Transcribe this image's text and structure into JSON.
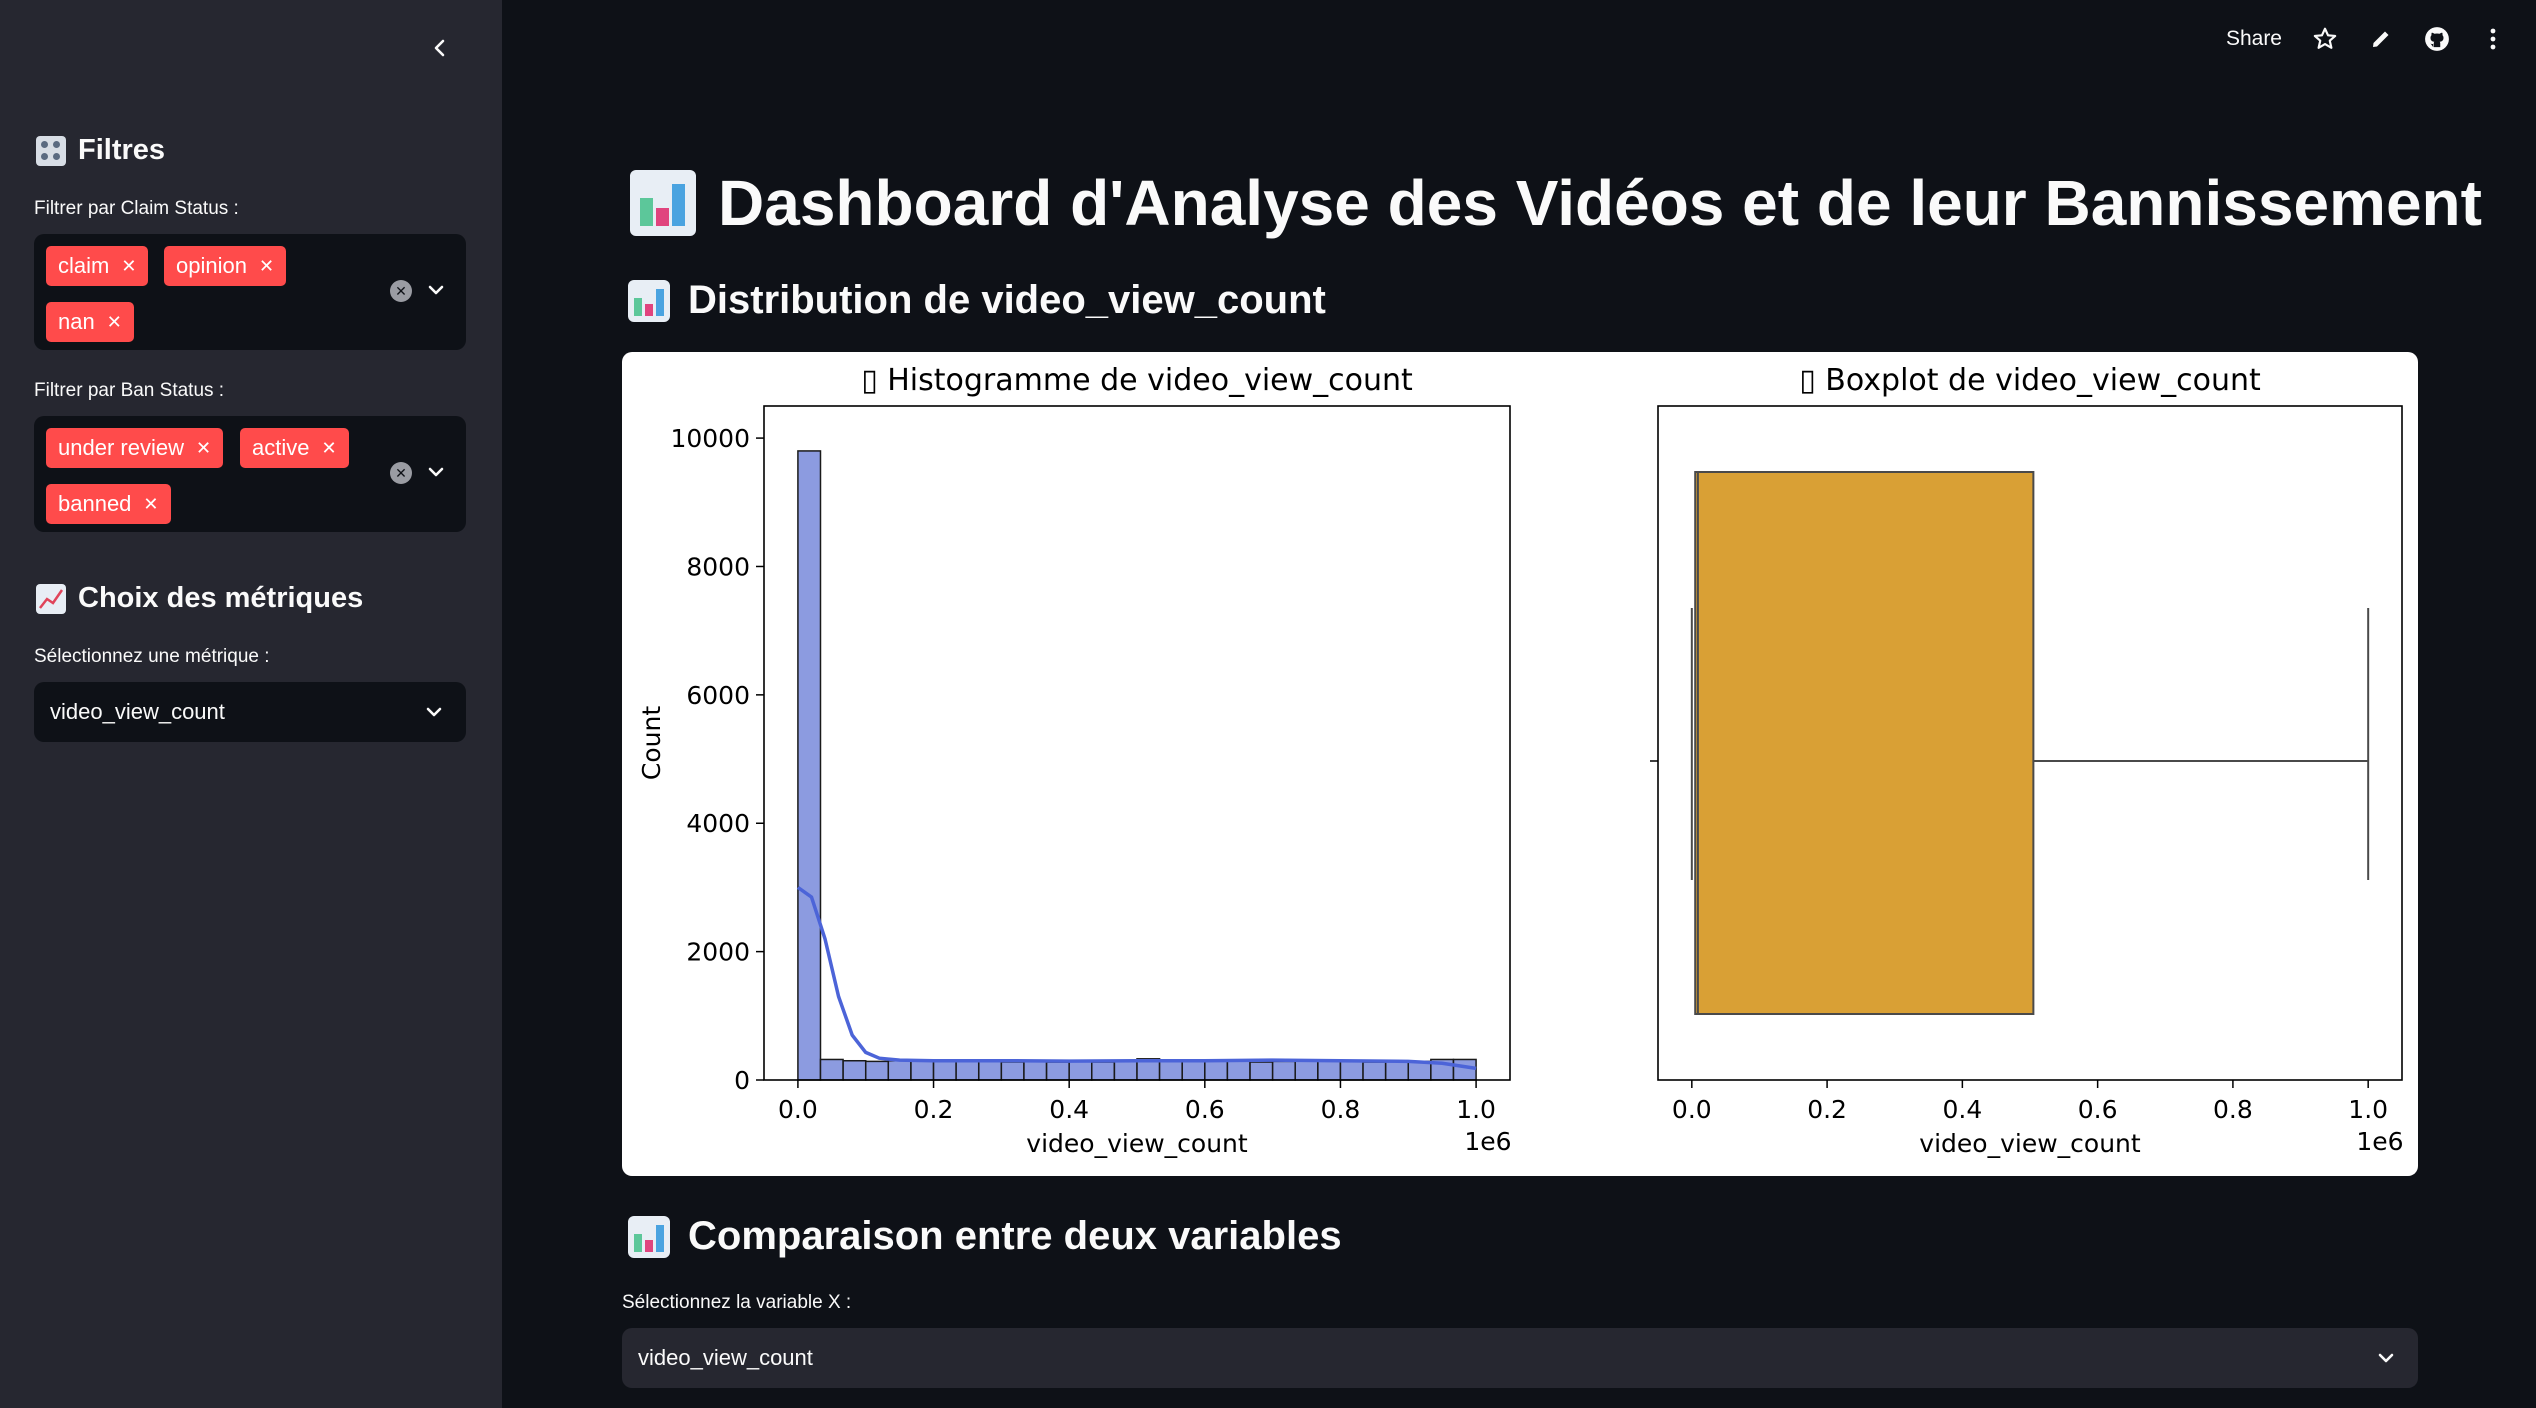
{
  "sidebar": {
    "filters_heading": "Filtres",
    "claim_label": "Filtrer par Claim Status :",
    "claim_tags": [
      "claim",
      "opinion",
      "nan"
    ],
    "ban_label": "Filtrer par Ban Status :",
    "ban_tags": [
      "under review",
      "active",
      "banned"
    ],
    "metrics_heading": "Choix des métriques",
    "metric_label": "Sélectionnez une métrique :",
    "metric_value": "video_view_count"
  },
  "toolbar": {
    "share_label": "Share"
  },
  "main": {
    "title": "Dashboard d'Analyse des Vidéos et de leur Bannissement",
    "dist_title": "Distribution de video_view_count",
    "compare_title": "Comparaison entre deux variables",
    "x_label": "Sélectionnez la variable X :",
    "x_value": "video_view_count"
  },
  "colors": {
    "accent": "#ff4b4b",
    "hist": "#8c9be0",
    "kde": "#4c64d8",
    "box": "#d9a035"
  },
  "chart_data": [
    {
      "type": "bar",
      "title": "▯ Histogramme de video_view_count",
      "xlabel": "video_view_count",
      "ylabel": "Count",
      "x_multiplier": "1e6",
      "xlim": [
        -0.05,
        1.05
      ],
      "ylim": [
        0,
        10500
      ],
      "x_ticks": [
        "0.0",
        "0.2",
        "0.4",
        "0.6",
        "0.8",
        "1.0"
      ],
      "y_ticks": [
        "0",
        "2000",
        "4000",
        "6000",
        "8000",
        "10000"
      ],
      "bin_width": 0.0333,
      "bin_starts": [
        0.0,
        0.0333,
        0.0667,
        0.1,
        0.1333,
        0.1667,
        0.2,
        0.2333,
        0.2667,
        0.3,
        0.3333,
        0.3667,
        0.4,
        0.4333,
        0.4667,
        0.5,
        0.5333,
        0.5667,
        0.6,
        0.6333,
        0.6667,
        0.7,
        0.7333,
        0.7667,
        0.8,
        0.8333,
        0.8667,
        0.9,
        0.9333,
        0.9667
      ],
      "values": [
        9800,
        320,
        300,
        290,
        300,
        300,
        290,
        295,
        290,
        280,
        290,
        280,
        300,
        280,
        300,
        330,
        310,
        290,
        300,
        300,
        280,
        290,
        300,
        310,
        300,
        280,
        300,
        290,
        320,
        320
      ],
      "kde": {
        "x": [
          0.0,
          0.02,
          0.04,
          0.06,
          0.08,
          0.1,
          0.12,
          0.15,
          0.2,
          0.3,
          0.4,
          0.5,
          0.6,
          0.7,
          0.8,
          0.9,
          0.95,
          1.0
        ],
        "y": [
          3000,
          2850,
          2200,
          1300,
          700,
          430,
          340,
          310,
          300,
          300,
          295,
          300,
          300,
          310,
          300,
          290,
          260,
          180
        ]
      }
    },
    {
      "type": "box",
      "title": "▯ Boxplot de video_view_count",
      "xlabel": "video_view_count",
      "x_multiplier": "1e6",
      "xlim": [
        -0.05,
        1.05
      ],
      "x_ticks": [
        "0.0",
        "0.2",
        "0.4",
        "0.6",
        "0.8",
        "1.0"
      ],
      "whisker_low": 0.0,
      "q1": 0.005,
      "median": 0.009,
      "q3": 0.505,
      "whisker_high": 1.0
    }
  ]
}
